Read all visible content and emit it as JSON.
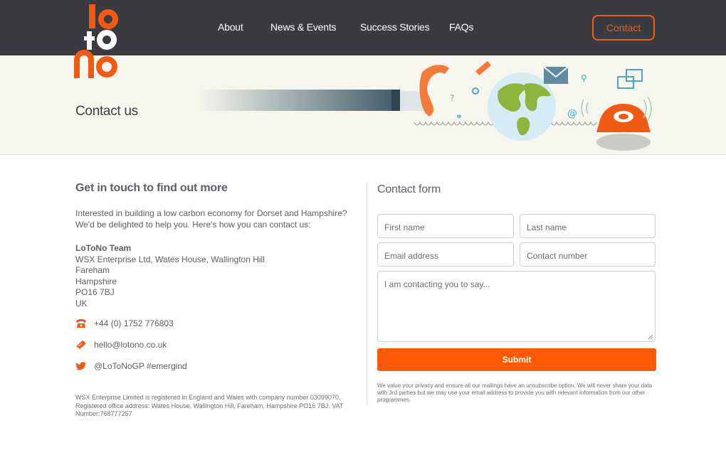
{
  "brand": {
    "name": "LoToNo",
    "color_orange": "#f25a12",
    "color_dark": "#3a3b40",
    "submit_color": "#fe5a06"
  },
  "nav": {
    "items": [
      {
        "label": "About"
      },
      {
        "label": "News & Events"
      },
      {
        "label": "Success Stories"
      },
      {
        "label": "FAQs"
      }
    ],
    "contact_label": "Contact"
  },
  "hero": {
    "title": "Contact us"
  },
  "left": {
    "heading": "Get in touch to find out more",
    "intro": "Interested in building a low carbon economy for Dorset and Hampshire? We'd be delighted to help you. Here's how you can contact us:",
    "address": {
      "team": "LoToNo Team",
      "lines": [
        "WSX Enterprise Ltd, Wates House, Wallington Hill",
        "Fareham",
        "Hampshire",
        "PO16 7BJ",
        "UK"
      ]
    },
    "phone": {
      "icon": "phone-icon",
      "value": "+44 (0) 1752 776803"
    },
    "email": {
      "icon": "email-icon",
      "value": "hello@lotono.co.uk"
    },
    "twitter": {
      "icon": "twitter-icon",
      "value": "@LoToNoGP #emergind"
    },
    "legal": "WSX Enterprise Limited is registered in England and Wales with company number 03099070, Registered office address: Wates House, Wallington Hill, Fareham, Hampshire PO16 7BJ. VAT Number:768777257"
  },
  "form": {
    "title": "Contact form",
    "first_name": "First name",
    "last_name": "Last name",
    "email": "Email address",
    "phone": "Contact number",
    "message": "I am contacting you to say...",
    "submit": "Submit",
    "privacy": "We value your privacy and ensure all our mailings have an unsubscribe option. We will never share your data with 3rd parties but we may use your email address to provide you with relevant information from our other programmes."
  }
}
